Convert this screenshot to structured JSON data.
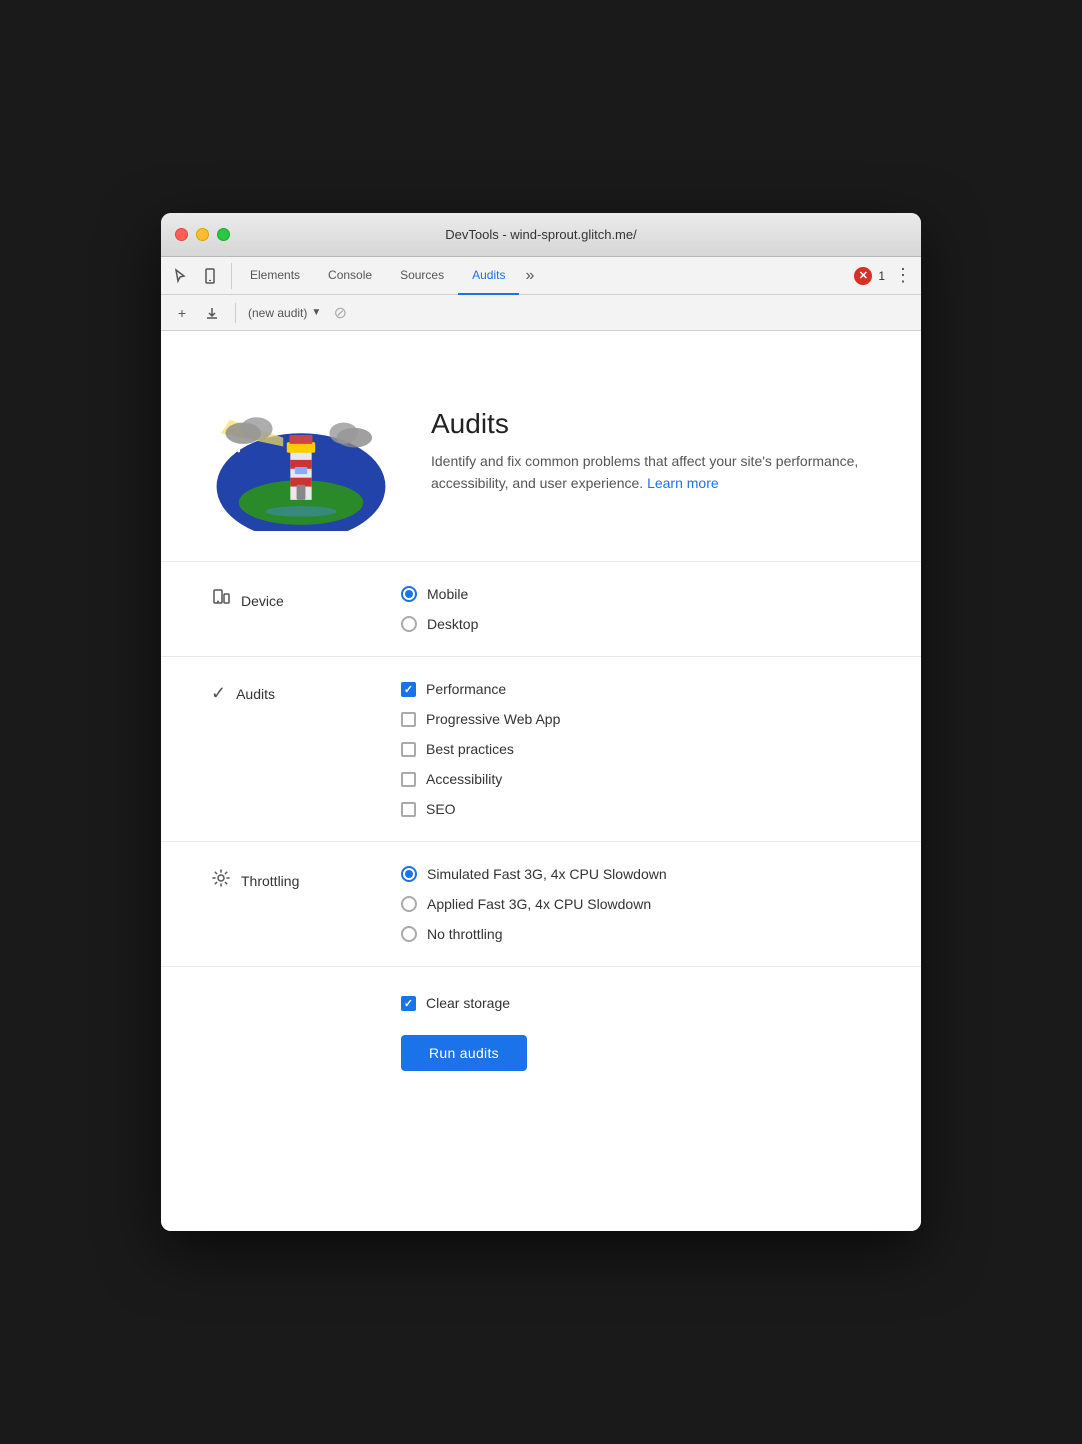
{
  "window": {
    "title": "DevTools - wind-sprout.glitch.me/"
  },
  "titlebar": {
    "title": "DevTools - wind-sprout.glitch.me/"
  },
  "tabs": [
    {
      "label": "Elements",
      "active": false
    },
    {
      "label": "Console",
      "active": false
    },
    {
      "label": "Sources",
      "active": false
    },
    {
      "label": "Audits",
      "active": true
    }
  ],
  "tabs_more": "»",
  "error_count": "1",
  "toolbar": {
    "new_label": "+",
    "download_label": "⬇",
    "audit_placeholder": "(new audit)",
    "block_label": "⊘"
  },
  "hero": {
    "title": "Audits",
    "description": "Identify and fix common problems that affect your site's performance, accessibility, and user experience.",
    "learn_more": "Learn more"
  },
  "device_section": {
    "label": "Device",
    "options": [
      {
        "label": "Mobile",
        "checked": true
      },
      {
        "label": "Desktop",
        "checked": false
      }
    ]
  },
  "audits_section": {
    "label": "Audits",
    "options": [
      {
        "label": "Performance",
        "checked": true
      },
      {
        "label": "Progressive Web App",
        "checked": false
      },
      {
        "label": "Best practices",
        "checked": false
      },
      {
        "label": "Accessibility",
        "checked": false
      },
      {
        "label": "SEO",
        "checked": false
      }
    ]
  },
  "throttling_section": {
    "label": "Throttling",
    "options": [
      {
        "label": "Simulated Fast 3G, 4x CPU Slowdown",
        "checked": true
      },
      {
        "label": "Applied Fast 3G, 4x CPU Slowdown",
        "checked": false
      },
      {
        "label": "No throttling",
        "checked": false
      }
    ]
  },
  "bottom": {
    "clear_storage_label": "Clear storage",
    "clear_storage_checked": true,
    "run_button": "Run audits"
  }
}
